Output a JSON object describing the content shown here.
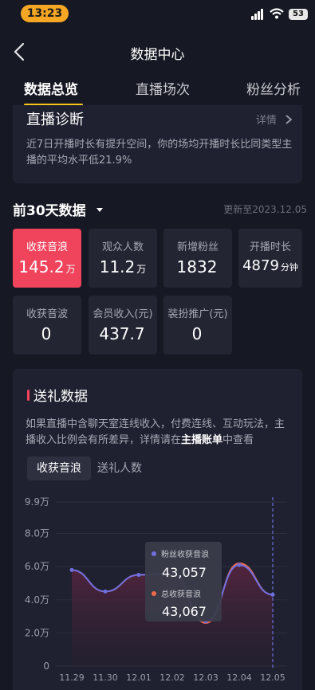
{
  "status": {
    "time": "13:23",
    "battery": "53"
  },
  "nav": {
    "title": "数据中心"
  },
  "tabs": [
    "数据总览",
    "直播场次",
    "粉丝分析"
  ],
  "diagnosis": {
    "title": "直播诊断",
    "detail": "详情",
    "text": "近7日开播时长有提升空间，你的场均开播时长比同类型主播的平均水平低21.9%"
  },
  "period": {
    "title": "前30天数据",
    "updated": "更新至2023.12.05"
  },
  "stats": [
    {
      "label": "收获音浪",
      "value": "145.2",
      "unit": "万"
    },
    {
      "label": "观众人数",
      "value": "11.2",
      "unit": "万"
    },
    {
      "label": "新增粉丝",
      "value": "1832",
      "unit": ""
    },
    {
      "label": "开播时长",
      "value": "4879",
      "unit": "分钟"
    },
    {
      "label": "收获音波",
      "value": "0",
      "unit": ""
    },
    {
      "label": "会员收入(元)",
      "value": "437.7",
      "unit": ""
    },
    {
      "label": "装扮推广(元)",
      "value": "0",
      "unit": ""
    }
  ],
  "gift": {
    "title": "送礼数据",
    "desc_before": "如果直播中含聊天室连线收入，付费连线、互动玩法，主播收入比例会有所差异，详情请在",
    "desc_link": "主播账单",
    "desc_after": "中查看",
    "segments": [
      "收获音浪",
      "送礼人数"
    ]
  },
  "tooltip": {
    "s1_label": "粉丝收获音浪",
    "s1_value": "43,057",
    "s2_label": "总收获音浪",
    "s2_value": "43,067"
  },
  "colors": {
    "accent": "#f0435c",
    "tab_indicator": "#f5c518",
    "series1": "#6f6fe0",
    "series2": "#f06a4a"
  },
  "chart_data": {
    "type": "area",
    "categories": [
      "11.29",
      "11.30",
      "12.01",
      "12.02",
      "12.03",
      "12.04",
      "12.05"
    ],
    "ytick_labels": [
      "0",
      "2.0万",
      "4.0万",
      "6.0万",
      "8.0万",
      "9.9万"
    ],
    "ylim": [
      0,
      99000
    ],
    "series": [
      {
        "name": "粉丝收获音浪",
        "values": [
          58000,
          45000,
          55000,
          56000,
          27000,
          61000,
          43057
        ]
      },
      {
        "name": "总收获音浪",
        "values": [
          58000,
          45000,
          55000,
          56000,
          26000,
          62000,
          43067
        ]
      }
    ]
  }
}
